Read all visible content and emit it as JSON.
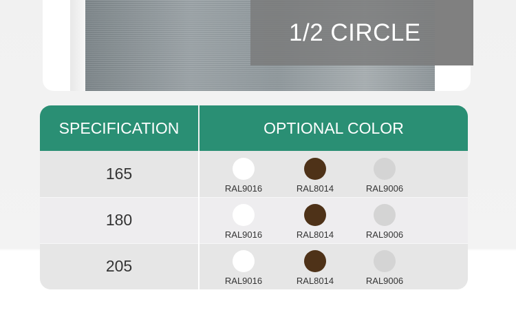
{
  "product": {
    "label": "1/2 CIRCLE"
  },
  "table": {
    "headers": {
      "specification": "SPECIFICATION",
      "optional_color": "OPTIONAL COLOR"
    },
    "rows": [
      {
        "spec": "165",
        "colors": [
          {
            "code": "RAL9016",
            "hex": "#ffffff"
          },
          {
            "code": "RAL8014",
            "hex": "#4e3218"
          },
          {
            "code": "RAL9006",
            "hex": "#d4d4d4"
          }
        ]
      },
      {
        "spec": "180",
        "colors": [
          {
            "code": "RAL9016",
            "hex": "#ffffff"
          },
          {
            "code": "RAL8014",
            "hex": "#4e3218"
          },
          {
            "code": "RAL9006",
            "hex": "#d4d4d4"
          }
        ]
      },
      {
        "spec": "205",
        "colors": [
          {
            "code": "RAL9016",
            "hex": "#ffffff"
          },
          {
            "code": "RAL8014",
            "hex": "#4e3218"
          },
          {
            "code": "RAL9006",
            "hex": "#d4d4d4"
          }
        ]
      }
    ]
  },
  "theme": {
    "header_green": "#2a8f74"
  }
}
